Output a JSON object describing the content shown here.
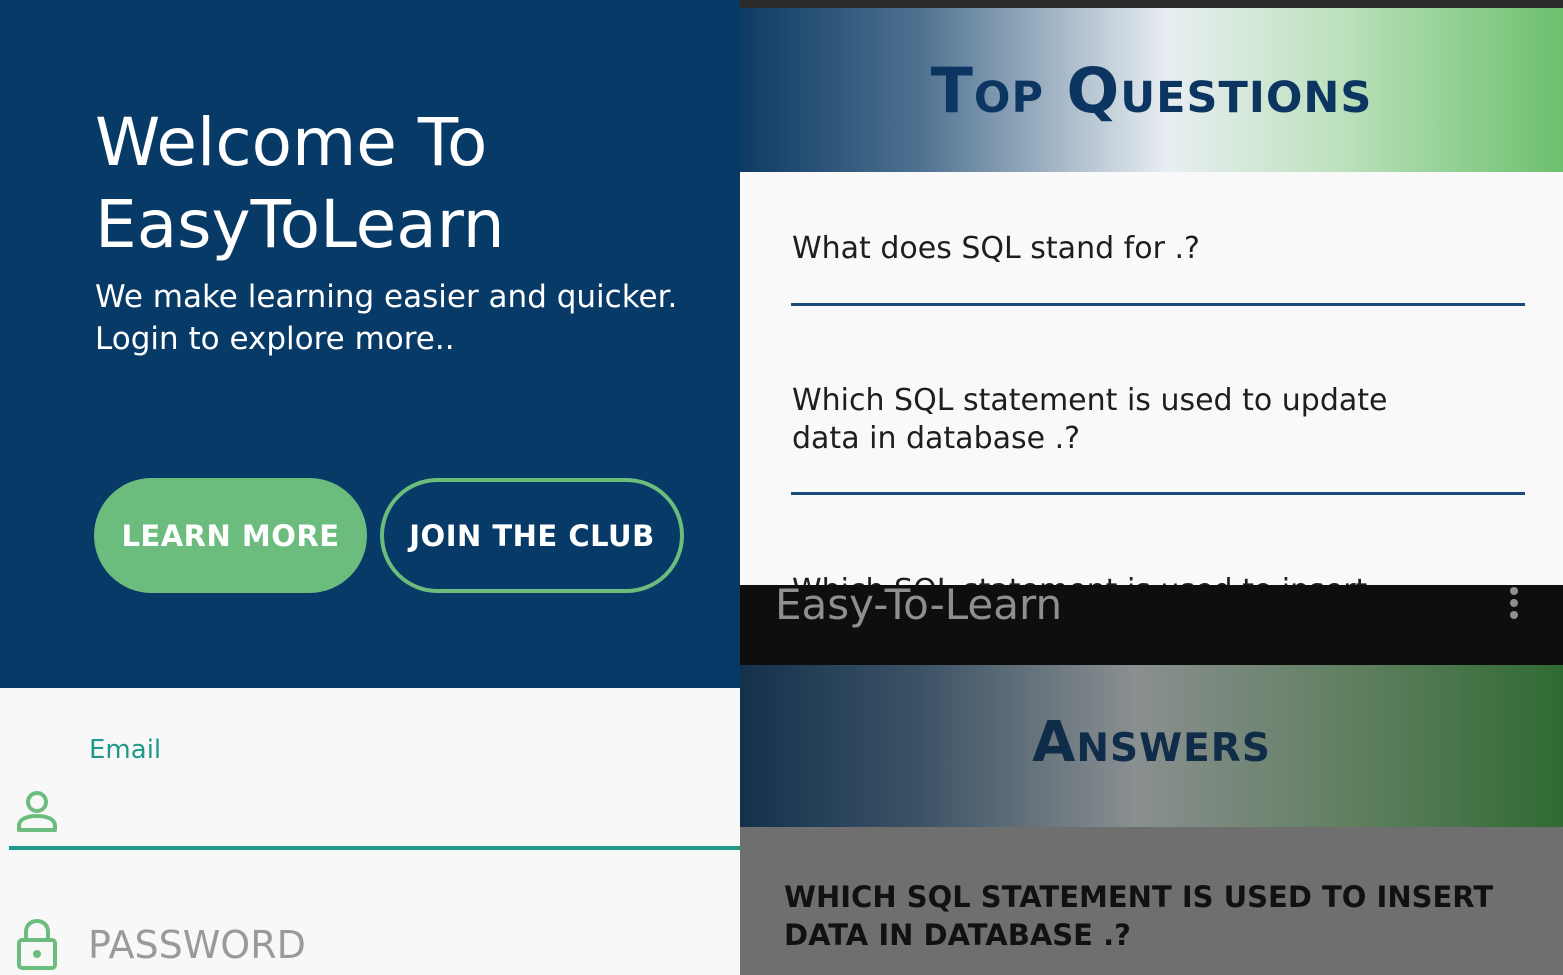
{
  "login": {
    "welcome_title": "Welcome To EasyToLearn",
    "tagline": "We make learning easier and quicker. Login to explore more..",
    "learn_more_label": "LEARN MORE",
    "join_club_label": "JOIN THE CLUB",
    "email_label": "Email",
    "email_value": "",
    "password_placeholder": "PASSWORD",
    "icons": {
      "email": "user-icon",
      "password": "lock-icon"
    }
  },
  "top_questions": {
    "title": "Top Questions",
    "items": [
      {
        "text": "What does SQL stand for .?"
      },
      {
        "text": "Which SQL statement is used to update data in database .?"
      },
      {
        "text": "Which SQL statement is used to insert data"
      }
    ]
  },
  "answers": {
    "app_title": "Easy-To-Learn",
    "menu_icon": "more-vertical-icon",
    "title": "Answers",
    "question": "WHICH SQL STATEMENT IS USED TO INSERT DATA IN DATABASE .?"
  },
  "colors": {
    "navy": "#083a68",
    "accent_green": "#6cbd7d",
    "teal": "#1f9a8a",
    "divider_blue": "#1a4b7a"
  }
}
